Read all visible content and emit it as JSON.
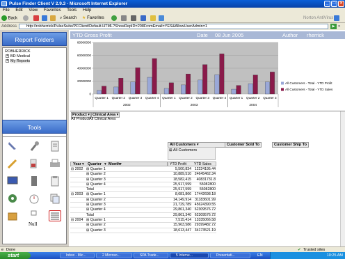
{
  "window": {
    "title": "Pulse Finder Client V 2.9.3 - Microsoft Internet Explorer"
  },
  "menu": [
    "File",
    "Edit",
    "View",
    "Favorites",
    "Tools",
    "Help"
  ],
  "toolbar": {
    "back": "Back",
    "search": "Search",
    "favorites": "Favorites",
    "norton": "Norton AntiVirus"
  },
  "address": {
    "label": "Address",
    "url": "http://robherrick/PulseSuite/PFClient/Default.HTML?ShowRepID=208FromEmail=YES&AllowUserAdmin=1"
  },
  "left": {
    "report_folders_title": "Report Folders",
    "tree": [
      {
        "label": "ROBHERRICK",
        "toggle": ""
      },
      {
        "label": "BD Medical",
        "toggle": "+"
      },
      {
        "label": "My Reports",
        "toggle": "+"
      }
    ],
    "tools_title": "Tools",
    "tools_null_label": "Null"
  },
  "report": {
    "title": "YTD Gross Profit",
    "date_label": "Date",
    "date": "08 Jun 2005",
    "author_label": "Author",
    "author": "rherrick"
  },
  "chart_data": {
    "type": "bar",
    "categories": [
      "Quarter 1",
      "Quarter 2",
      "Quarter 3",
      "Quarter 4",
      "Quarter 1",
      "Quarter 2",
      "Quarter 3",
      "Quarter 4",
      "Quarter 1",
      "Quarter 2",
      "Quarter 3"
    ],
    "groups": [
      "2002",
      "2003",
      "2004"
    ],
    "series": [
      {
        "name": "All Customers - Total - YTD Profit",
        "color": "#9aa8d8",
        "values": [
          5500834,
          10889510,
          18582415,
          25917599,
          8681866,
          14149914,
          21729789,
          29861340,
          7515414,
          15963586,
          18613447
        ]
      },
      {
        "name": "All Customers - Total - YTD Sales",
        "color": "#8a1a4a",
        "values": [
          12224195,
          24645462,
          40831732,
          55082800,
          17442698,
          31183601,
          45624390,
          62309577,
          13335066,
          29399482,
          34173521
        ]
      }
    ],
    "ylim": [
      0,
      80000000
    ],
    "yticks": [
      "80000000",
      "60000000",
      "40000000",
      "20000000",
      "0"
    ]
  },
  "pivot": {
    "page_fields": [
      "Product",
      "Clinical Area"
    ],
    "page_values": [
      "All Product",
      "All Clinical Area"
    ],
    "col_fields": [
      "All Customers",
      "Customer Sold To",
      "Customer Ship To"
    ],
    "col_value": "All Customers",
    "row_fields": [
      "Year",
      "Quarter",
      "Month"
    ],
    "measures": [
      "YTD Profit",
      "YTD Sales"
    ],
    "rows": [
      {
        "year": "2002",
        "quarter": "Quarter 1",
        "profit": "5,500,834",
        "sales": "12224195.44"
      },
      {
        "year": "",
        "quarter": "Quarter 2",
        "profit": "10,889,510",
        "sales": "24645462.34"
      },
      {
        "year": "",
        "quarter": "Quarter 3",
        "profit": "18,582,415",
        "sales": "40831731.8"
      },
      {
        "year": "",
        "quarter": "Quarter 4",
        "profit": "25,917,599",
        "sales": "55082800"
      },
      {
        "year": "",
        "quarter": "Total",
        "profit": "25,917,599",
        "sales": "55082800"
      },
      {
        "year": "2003",
        "quarter": "Quarter 1",
        "profit": "8,681,866",
        "sales": "17442698.18"
      },
      {
        "year": "",
        "quarter": "Quarter 2",
        "profit": "14,149,914",
        "sales": "31183601.99"
      },
      {
        "year": "",
        "quarter": "Quarter 3",
        "profit": "21,729,789",
        "sales": "45624390.55"
      },
      {
        "year": "",
        "quarter": "Quarter 4",
        "profit": "29,861,340",
        "sales": "62309576.72"
      },
      {
        "year": "",
        "quarter": "Total",
        "profit": "29,861,340",
        "sales": "62309576.72"
      },
      {
        "year": "2004",
        "quarter": "Quarter 1",
        "profit": "7,515,414",
        "sales": "13335066.58"
      },
      {
        "year": "",
        "quarter": "Quarter 2",
        "profit": "15,963,586",
        "sales": "29399482.72"
      },
      {
        "year": "",
        "quarter": "Quarter 3",
        "profit": "18,613,447",
        "sales": "34173521.19"
      }
    ]
  },
  "status": {
    "left": "Done",
    "zone": "Trusted sites"
  },
  "taskbar": {
    "start": "start",
    "tasks": [
      "Inbox - Mic...",
      "2 Microso...",
      "SPA Trade...",
      "5 Interne...",
      "Presentati..."
    ],
    "lang": "EN",
    "clock": "10:25 AM"
  }
}
